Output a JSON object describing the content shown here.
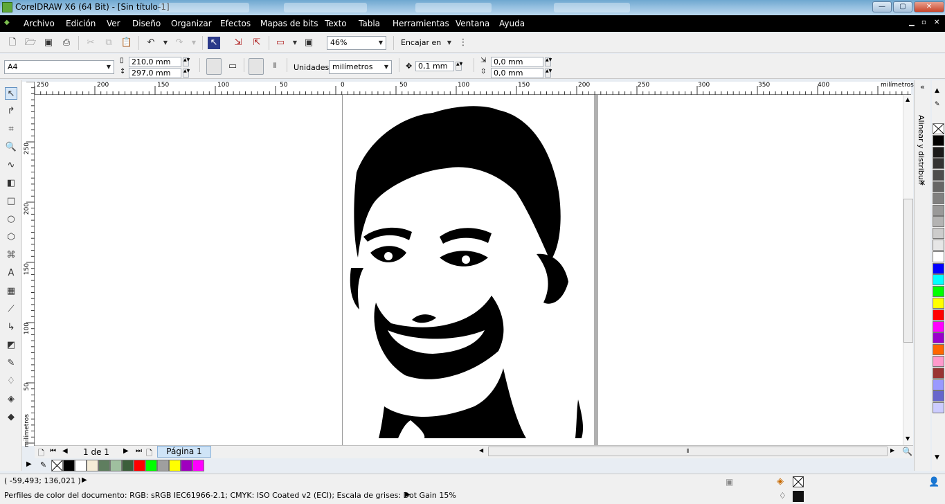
{
  "window": {
    "title": "CorelDRAW X6 (64 Bit) - [Sin título-1]",
    "min": "—",
    "max": "▢",
    "close": "✕"
  },
  "menu": {
    "items": [
      "Archivo",
      "Edición",
      "Ver",
      "Diseño",
      "Organizar",
      "Efectos",
      "Mapas de bits",
      "Texto",
      "Tabla",
      "Herramientas",
      "Ventana",
      "Ayuda"
    ],
    "doc_controls": [
      "▁",
      "▫",
      "✕"
    ]
  },
  "toolbar": {
    "zoom_value": "46%",
    "fit_label": "Encajar en",
    "icons": [
      "new-icon",
      "open-icon",
      "save-icon",
      "print-icon",
      "cut-icon",
      "copy-icon",
      "paste-icon",
      "undo-icon",
      "redo-icon",
      "search-content-icon",
      "import-icon",
      "export-icon",
      "publish-icon",
      "fullscreen-icon",
      "welcome-icon",
      "snap-icon"
    ]
  },
  "property_bar": {
    "page_size": "A4",
    "width": "210,0 mm",
    "height": "297,0 mm",
    "units_label": "Unidades:",
    "units_value": "milímetros",
    "nudge": "0,1 mm",
    "dup_x": "0,0 mm",
    "dup_y": "0,0 mm"
  },
  "rulers": {
    "h_ticks": [
      "250",
      "200",
      "150",
      "100",
      "50",
      "0",
      "50",
      "100",
      "150",
      "200",
      "250",
      "300",
      "350",
      "400"
    ],
    "h_unit": "milímetros",
    "v_ticks": [
      "250",
      "200",
      "150",
      "100",
      "50"
    ],
    "v_unit": "milímetros"
  },
  "page_nav": {
    "counter": "1 de 1",
    "tab_label": "Página 1"
  },
  "docker": {
    "label": "Alinear y distribuir",
    "close": "✕"
  },
  "palette_bottom": [
    "none",
    "#000000",
    "#ffffff",
    "#f5ecd7",
    "#5f7e5f",
    "#9fbf9f",
    "#3b5f3b",
    "#ff0000",
    "#00ff00",
    "#9f9f9f",
    "#ffff00",
    "#9f00bf",
    "#ff00ff"
  ],
  "palette_right": [
    "none",
    "#000000",
    "#1a1a1a",
    "#333333",
    "#4d4d4d",
    "#666666",
    "#808080",
    "#999999",
    "#b3b3b3",
    "#cccccc",
    "#e6e6e6",
    "#ffffff",
    "#0000ff",
    "#00ffff",
    "#00ff00",
    "#ffff00",
    "#ff0000",
    "#ff00ff",
    "#9900cc",
    "#ff6600",
    "#ff99cc",
    "#993333",
    "#9999ff",
    "#6666cc",
    "#ccccff"
  ],
  "status": {
    "coords": "( -59,493; 136,021 )",
    "profiles": "Perfiles de color del documento: RGB: sRGB IEC61966-2.1; CMYK: ISO Coated v2 (ECI); Escala de grises: Dot Gain 15%"
  }
}
